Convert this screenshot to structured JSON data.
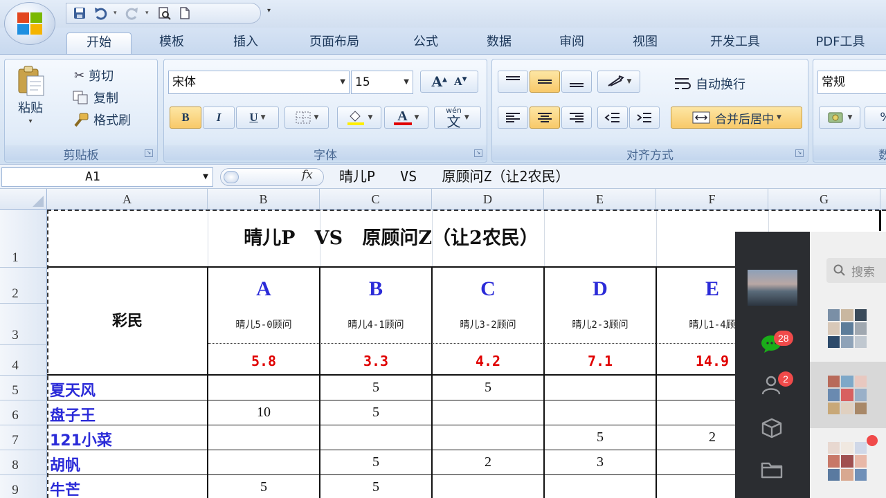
{
  "quick_access": {
    "save": "save-icon",
    "undo": "undo-icon",
    "redo": "redo-icon",
    "print_preview": "print-preview-icon",
    "new": "new-document-icon",
    "more": "▾"
  },
  "tabs": [
    "开始",
    "模板",
    "插入",
    "页面布局",
    "公式",
    "数据",
    "审阅",
    "视图",
    "开发工具",
    "PDF工具"
  ],
  "active_tab": "开始",
  "clipboard": {
    "paste": "粘贴",
    "cut": "剪切",
    "copy": "复制",
    "format_painter": "格式刷",
    "label": "剪贴板"
  },
  "font": {
    "name": "宋体",
    "size": "15",
    "grow": "A",
    "shrink": "A",
    "bold": "B",
    "italic": "I",
    "underline": "U",
    "font_color_letter": "A",
    "phonetic": "wén",
    "phonetic_char": "文",
    "label": "字体"
  },
  "alignment": {
    "wrap_text": "自动换行",
    "merge_center": "合并后居中",
    "label": "对齐方式"
  },
  "number": {
    "format": "常规",
    "percent": "%",
    "label": "数"
  },
  "formula_bar": {
    "name_box": "A1",
    "fx": "fx",
    "content": "晴儿P   VS   原顾问Z（让2农民）"
  },
  "columns": [
    "A",
    "B",
    "C",
    "D",
    "E",
    "F",
    "G"
  ],
  "rows": [
    "1",
    "2",
    "3",
    "4",
    "5",
    "6",
    "7",
    "8",
    "9"
  ],
  "sheet": {
    "title": "晴儿P   VS   原顾问Z（让2农民）",
    "header_label": "彩民",
    "options": [
      {
        "letter": "A",
        "desc": "晴儿5-0顾问",
        "odds": "5.8"
      },
      {
        "letter": "B",
        "desc": "晴儿4-1顾问",
        "odds": "3.3"
      },
      {
        "letter": "C",
        "desc": "晴儿3-2顾问",
        "odds": "4.2"
      },
      {
        "letter": "D",
        "desc": "晴儿2-3顾问",
        "odds": "7.1"
      },
      {
        "letter": "E",
        "desc": "晴儿1-4顾",
        "odds": "14.9"
      }
    ],
    "players": [
      {
        "name": "夏天风",
        "values": [
          "",
          "5",
          "5",
          "",
          ""
        ]
      },
      {
        "name": "盘子王",
        "values": [
          "10",
          "5",
          "",
          "",
          ""
        ]
      },
      {
        "name": "121小菜",
        "values": [
          "",
          "",
          "",
          "5",
          "2"
        ]
      },
      {
        "name": "胡帆",
        "values": [
          "",
          "5",
          "2",
          "3",
          ""
        ]
      },
      {
        "name": "牛芒",
        "values": [
          "5",
          "5",
          "",
          "",
          ""
        ]
      }
    ]
  },
  "chat_panel": {
    "search_placeholder": "搜索",
    "chat_badge": "28",
    "contacts_badge": "2",
    "icons": [
      "chat-icon",
      "contacts-icon",
      "cube-icon",
      "folder-icon"
    ]
  },
  "colors": {
    "player_blue": "#2b2bd8",
    "odds_red": "#e00000",
    "badge_red": "#f04a4a",
    "ribbon_blue": "#dbe7f5"
  }
}
